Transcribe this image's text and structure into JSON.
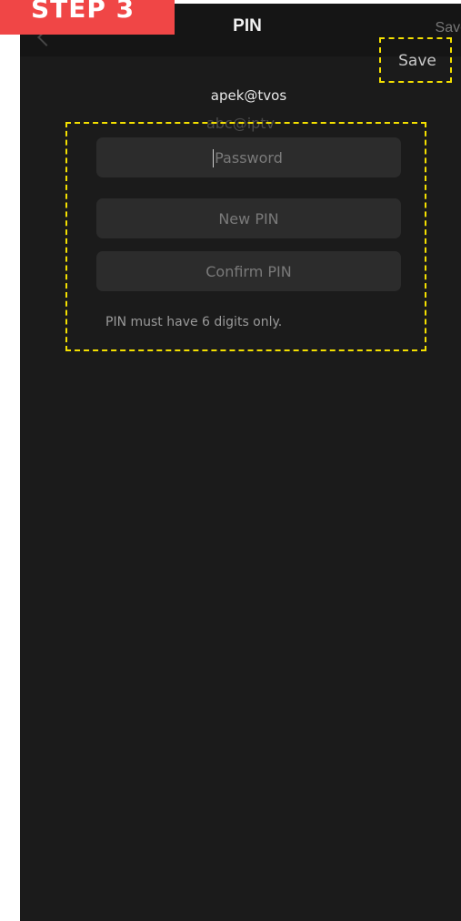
{
  "step_badge": {
    "label": "STEP 3"
  },
  "nav": {
    "title": "PIN",
    "save_label": "Save",
    "save_ghost": "Save"
  },
  "account": {
    "username": "apek@tvos",
    "username_ghost": "abc@iptv"
  },
  "form": {
    "password_placeholder": "Password",
    "new_pin_placeholder": "New PIN",
    "confirm_pin_placeholder": "Confirm PIN",
    "hint": "PIN must have 6 digits only."
  },
  "colors": {
    "background": "#1b1b1b",
    "field": "#2c2c2c",
    "highlight": "#f4e000",
    "badge": "#f04646"
  },
  "icons": {
    "back": "chevron-left-icon"
  }
}
